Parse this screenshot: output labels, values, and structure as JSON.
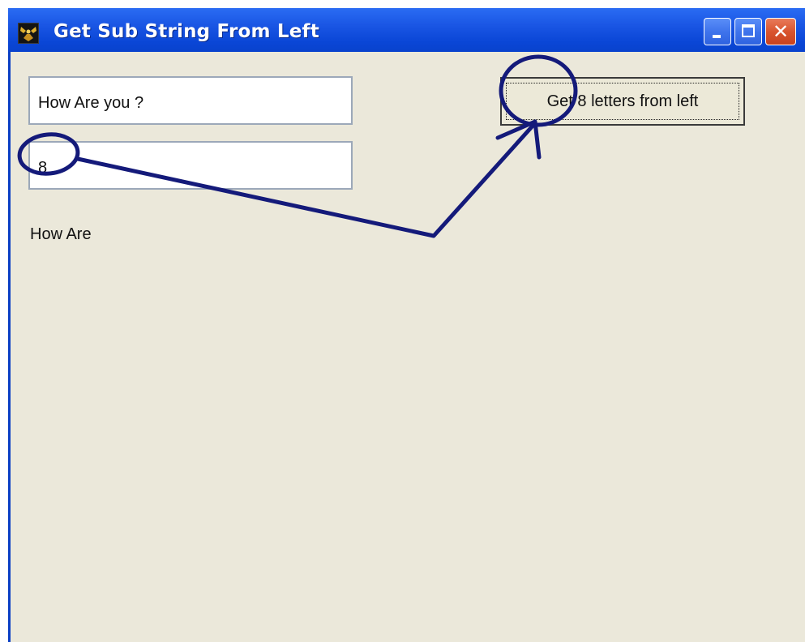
{
  "window": {
    "title": "Get Sub String From Left",
    "controls": {
      "minimize_icon": "minimize-icon",
      "maximize_icon": "maximize-icon",
      "close_label": "✕"
    }
  },
  "form": {
    "source_text": "How Are you ?",
    "count_text": "8",
    "result_text": "How Are",
    "button_label": "Get 8 letters from left"
  },
  "annotation": {
    "color": "#141a7a"
  }
}
